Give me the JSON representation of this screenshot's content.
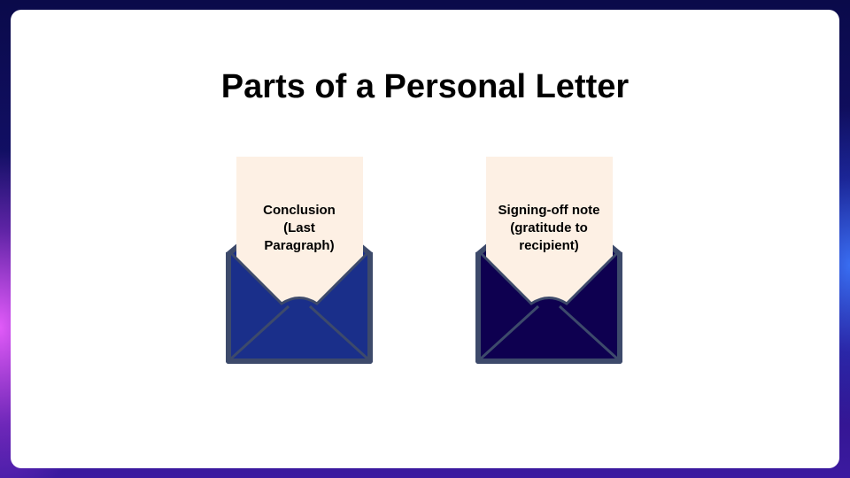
{
  "slide": {
    "title": "Parts of a Personal Letter",
    "cards": [
      {
        "text": "Conclusion\n(Last\nParagraph)",
        "envelope_color": "#1a2f8a",
        "icon": "envelope-letter-icon"
      },
      {
        "text": "Signing-off  note\n(gratitude  to\nrecipient)",
        "envelope_color": "#0e0050",
        "icon": "envelope-letter-icon"
      }
    ]
  },
  "colors": {
    "paper": "#fdf0e4",
    "envelope_border": "#3d4a6b",
    "background_frame": "#13106a"
  }
}
